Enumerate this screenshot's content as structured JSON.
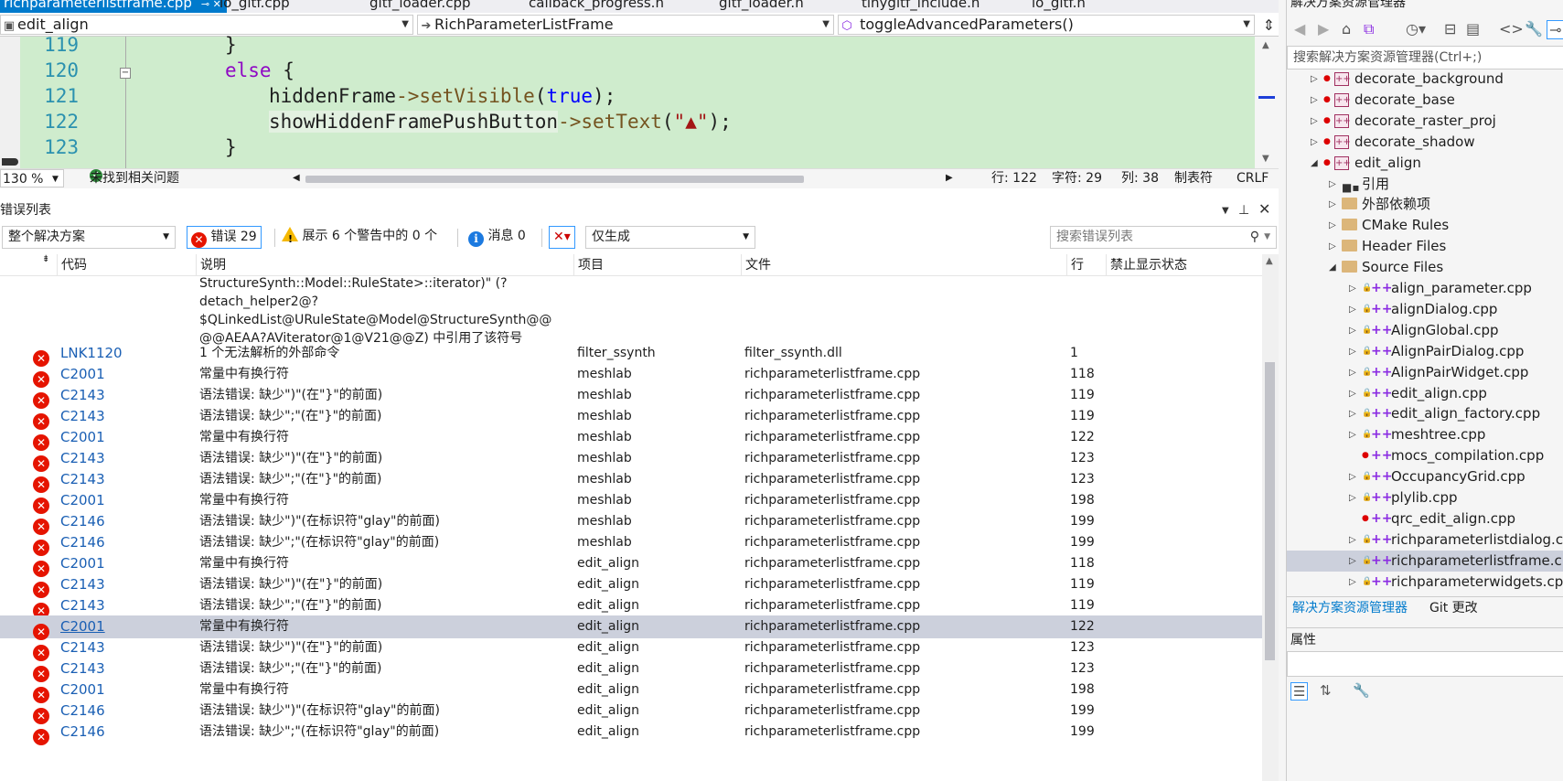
{
  "tabs": [
    {
      "label": "richparameterlistframe.cpp",
      "active": true
    },
    {
      "label": "io_gltf.cpp"
    },
    {
      "label": "gltf_loader.cpp"
    },
    {
      "label": "callback_progress.h"
    },
    {
      "label": "gltf_loader.h"
    },
    {
      "label": "tinygltf_include.h"
    },
    {
      "label": "io_gltf.h"
    }
  ],
  "nav": {
    "project": "edit_align",
    "class": "RichParameterListFrame",
    "member": "toggleAdvancedParameters()"
  },
  "code": {
    "lines": [
      {
        "num": "119",
        "text": "}"
      },
      {
        "num": "120",
        "keyword": "else",
        "rest": " {"
      },
      {
        "num": "121",
        "obj": "hiddenFrame",
        "arrow": "->",
        "fn": "setVisible",
        "open": "(",
        "arg": "true",
        "close": ");"
      },
      {
        "num": "122",
        "obj": "showHiddenFramePushButton",
        "arrow": "->",
        "fn": "setText",
        "open": "(",
        "arg": "\"▲\"",
        "close": ");"
      },
      {
        "num": "123",
        "text": "}"
      }
    ]
  },
  "status": {
    "zoom": "130 %",
    "issues": "未找到相关问题",
    "line": "行: 122",
    "char": "字符: 29",
    "col": "列: 38",
    "tabs": "制表符",
    "eol": "CRLF"
  },
  "error_list": {
    "title": "错误列表",
    "scope": "整个解决方案",
    "errors_btn": "错误 29",
    "warnings_btn": "展示 6 个警告中的 0 个",
    "messages_btn": "消息 0",
    "build_filter": "仅生成",
    "search_placeholder": "搜索错误列表",
    "columns": {
      "code": "代码",
      "desc": "说明",
      "project": "项目",
      "file": "文件",
      "line": "行",
      "suppress": "禁止显示状态"
    },
    "continuation": [
      "StructureSynth::Model::RuleState>::iterator)\" (?",
      "detach_helper2@?",
      "$QLinkedList@URuleState@Model@StructureSynth@@",
      "@@AEAA?AViterator@1@V21@@Z) 中引用了该符号"
    ],
    "rows": [
      {
        "code": "LNK1120",
        "desc": "1 个无法解析的外部命令",
        "project": "filter_ssynth",
        "file": "filter_ssynth.dll",
        "line": "1"
      },
      {
        "code": "C2001",
        "desc": "常量中有换行符",
        "project": "meshlab",
        "file": "richparameterlistframe.cpp",
        "line": "118"
      },
      {
        "code": "C2143",
        "desc": "语法错误: 缺少\")\"(在\"}\"的前面)",
        "project": "meshlab",
        "file": "richparameterlistframe.cpp",
        "line": "119"
      },
      {
        "code": "C2143",
        "desc": "语法错误: 缺少\";\"(在\"}\"的前面)",
        "project": "meshlab",
        "file": "richparameterlistframe.cpp",
        "line": "119"
      },
      {
        "code": "C2001",
        "desc": "常量中有换行符",
        "project": "meshlab",
        "file": "richparameterlistframe.cpp",
        "line": "122"
      },
      {
        "code": "C2143",
        "desc": "语法错误: 缺少\")\"(在\"}\"的前面)",
        "project": "meshlab",
        "file": "richparameterlistframe.cpp",
        "line": "123"
      },
      {
        "code": "C2143",
        "desc": "语法错误: 缺少\";\"(在\"}\"的前面)",
        "project": "meshlab",
        "file": "richparameterlistframe.cpp",
        "line": "123"
      },
      {
        "code": "C2001",
        "desc": "常量中有换行符",
        "project": "meshlab",
        "file": "richparameterlistframe.cpp",
        "line": "198"
      },
      {
        "code": "C2146",
        "desc": "语法错误: 缺少\")\"(在标识符\"glay\"的前面)",
        "project": "meshlab",
        "file": "richparameterlistframe.cpp",
        "line": "199"
      },
      {
        "code": "C2146",
        "desc": "语法错误: 缺少\";\"(在标识符\"glay\"的前面)",
        "project": "meshlab",
        "file": "richparameterlistframe.cpp",
        "line": "199"
      },
      {
        "code": "C2001",
        "desc": "常量中有换行符",
        "project": "edit_align",
        "file": "richparameterlistframe.cpp",
        "line": "118"
      },
      {
        "code": "C2143",
        "desc": "语法错误: 缺少\")\"(在\"}\"的前面)",
        "project": "edit_align",
        "file": "richparameterlistframe.cpp",
        "line": "119"
      },
      {
        "code": "C2143",
        "desc": "语法错误: 缺少\";\"(在\"}\"的前面)",
        "project": "edit_align",
        "file": "richparameterlistframe.cpp",
        "line": "119"
      },
      {
        "code": "C2001",
        "desc": "常量中有换行符",
        "project": "edit_align",
        "file": "richparameterlistframe.cpp",
        "line": "122",
        "selected": true
      },
      {
        "code": "C2143",
        "desc": "语法错误: 缺少\")\"(在\"}\"的前面)",
        "project": "edit_align",
        "file": "richparameterlistframe.cpp",
        "line": "123"
      },
      {
        "code": "C2143",
        "desc": "语法错误: 缺少\";\"(在\"}\"的前面)",
        "project": "edit_align",
        "file": "richparameterlistframe.cpp",
        "line": "123"
      },
      {
        "code": "C2001",
        "desc": "常量中有换行符",
        "project": "edit_align",
        "file": "richparameterlistframe.cpp",
        "line": "198"
      },
      {
        "code": "C2146",
        "desc": "语法错误: 缺少\")\"(在标识符\"glay\"的前面)",
        "project": "edit_align",
        "file": "richparameterlistframe.cpp",
        "line": "199"
      },
      {
        "code": "C2146",
        "desc": "语法错误: 缺少\";\"(在标识符\"glay\"的前面)",
        "project": "edit_align",
        "file": "richparameterlistframe.cpp",
        "line": "199"
      }
    ]
  },
  "solution_explorer": {
    "title": "解决方案资源管理器",
    "search_placeholder": "搜索解决方案资源管理器(Ctrl+;)",
    "items": [
      {
        "label": "decorate_background",
        "kind": "project",
        "depth": 0
      },
      {
        "label": "decorate_base",
        "kind": "project",
        "depth": 0
      },
      {
        "label": "decorate_raster_proj",
        "kind": "project",
        "depth": 0
      },
      {
        "label": "decorate_shadow",
        "kind": "project",
        "depth": 0
      },
      {
        "label": "edit_align",
        "kind": "project",
        "depth": 0,
        "expanded": true
      },
      {
        "label": "引用",
        "kind": "ref",
        "depth": 1
      },
      {
        "label": "外部依赖项",
        "kind": "folder",
        "depth": 1
      },
      {
        "label": "CMake Rules",
        "kind": "folder",
        "depth": 1
      },
      {
        "label": "Header Files",
        "kind": "folder",
        "depth": 1
      },
      {
        "label": "Source Files",
        "kind": "folder",
        "depth": 1,
        "expanded": true
      },
      {
        "label": "align_parameter.cpp",
        "kind": "file",
        "depth": 2
      },
      {
        "label": "alignDialog.cpp",
        "kind": "file",
        "depth": 2
      },
      {
        "label": "AlignGlobal.cpp",
        "kind": "file",
        "depth": 2
      },
      {
        "label": "AlignPairDialog.cpp",
        "kind": "file",
        "depth": 2
      },
      {
        "label": "AlignPairWidget.cpp",
        "kind": "file",
        "depth": 2
      },
      {
        "label": "edit_align.cpp",
        "kind": "file",
        "depth": 2
      },
      {
        "label": "edit_align_factory.cpp",
        "kind": "file",
        "depth": 2
      },
      {
        "label": "meshtree.cpp",
        "kind": "file",
        "depth": 2
      },
      {
        "label": "mocs_compilation.cpp",
        "kind": "file-noexp",
        "depth": 2
      },
      {
        "label": "OccupancyGrid.cpp",
        "kind": "file",
        "depth": 2
      },
      {
        "label": "plylib.cpp",
        "kind": "file",
        "depth": 2
      },
      {
        "label": "qrc_edit_align.cpp",
        "kind": "file-noexp",
        "depth": 2
      },
      {
        "label": "richparameterlistdialog.cpp",
        "kind": "file",
        "depth": 2
      },
      {
        "label": "richparameterlistframe.cpp",
        "kind": "file",
        "depth": 2,
        "selected": true
      },
      {
        "label": "richparameterwidgets.cpp",
        "kind": "file",
        "depth": 2
      }
    ],
    "tabs": [
      "解决方案资源管理器",
      "Git 更改"
    ],
    "properties_title": "属性"
  },
  "colors": {
    "accent": "#007acc",
    "error": "#e51400",
    "code_bg": "#cfeccd",
    "selected_row": "#ccd0dc"
  }
}
